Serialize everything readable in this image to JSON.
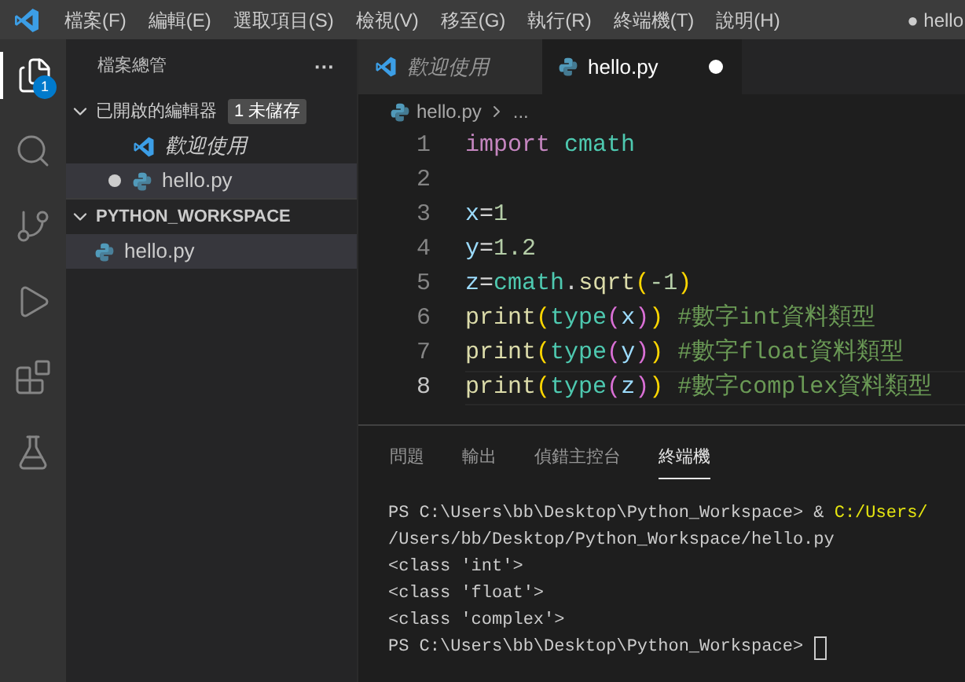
{
  "menu_bar": {
    "items": [
      "檔案(F)",
      "編輯(E)",
      "選取項目(S)",
      "檢視(V)",
      "移至(G)",
      "執行(R)",
      "終端機(T)",
      "說明(H)"
    ],
    "title": "● hello"
  },
  "activity_bar": {
    "items": [
      {
        "kind": "files",
        "selected": true,
        "badge": "1"
      },
      {
        "kind": "search",
        "selected": false
      },
      {
        "kind": "source-control",
        "selected": false
      },
      {
        "kind": "run",
        "selected": false
      },
      {
        "kind": "extensions",
        "selected": false
      },
      {
        "kind": "testing",
        "selected": false
      }
    ]
  },
  "sidebar": {
    "title": "檔案總管",
    "more": "···",
    "sections": [
      {
        "title": "已開啟的編輯器",
        "expanded": true,
        "badge": "1 未儲存",
        "items": [
          {
            "label": "歡迎使用",
            "kind": "welcome",
            "modified": false,
            "selected": false
          },
          {
            "label": "hello.py",
            "kind": "python",
            "modified": true,
            "selected": true
          }
        ]
      },
      {
        "title": "PYTHON_WORKSPACE",
        "expanded": true,
        "items": [
          {
            "label": "hello.py",
            "kind": "python",
            "selected": true
          }
        ]
      }
    ]
  },
  "editor": {
    "tabs": [
      {
        "label": "歡迎使用",
        "kind": "welcome",
        "selected": false,
        "modified": false
      },
      {
        "label": "hello.py",
        "kind": "python",
        "selected": true,
        "modified": true
      }
    ],
    "breadcrumb": [
      "hello.py",
      "..."
    ],
    "lines": [
      {
        "number": "1",
        "current": false,
        "tokens": [
          {
            "text": "import",
            "kind": "keyword"
          },
          {
            "text": " cmath",
            "kind": "module"
          }
        ]
      },
      {
        "number": "2",
        "current": false
      },
      {
        "number": "3",
        "current": false,
        "tokens": [
          {
            "text": "x",
            "kind": "variable"
          },
          {
            "text": "=",
            "kind": "plain"
          },
          {
            "text": "1",
            "kind": "number"
          }
        ]
      },
      {
        "number": "4",
        "current": false,
        "tokens": [
          {
            "text": "y",
            "kind": "variable"
          },
          {
            "text": "=",
            "kind": "plain"
          },
          {
            "text": "1.2",
            "kind": "number"
          }
        ]
      },
      {
        "number": "5",
        "current": false,
        "tokens": [
          {
            "text": "z",
            "kind": "variable"
          },
          {
            "text": "=",
            "kind": "plain"
          },
          {
            "text": "cmath",
            "kind": "module"
          },
          {
            "text": ".",
            "kind": "plain"
          },
          {
            "text": "sqrt",
            "kind": "function"
          },
          {
            "text": "(",
            "kind": "bracket"
          },
          {
            "text": "-1",
            "kind": "number"
          },
          {
            "text": ")",
            "kind": "bracket"
          }
        ]
      },
      {
        "number": "6",
        "current": false,
        "tokens": [
          {
            "text": "print",
            "kind": "function"
          },
          {
            "text": "(",
            "kind": "bracket"
          },
          {
            "text": "type",
            "kind": "module"
          },
          {
            "text": "(",
            "kind": "bracket2"
          },
          {
            "text": "x",
            "kind": "variable"
          },
          {
            "text": ")",
            "kind": "bracket2"
          },
          {
            "text": ")",
            "kind": "bracket"
          },
          {
            "text": " #數字int資料類型",
            "kind": "comment"
          }
        ]
      },
      {
        "number": "7",
        "current": false,
        "tokens": [
          {
            "text": "print",
            "kind": "function"
          },
          {
            "text": "(",
            "kind": "bracket"
          },
          {
            "text": "type",
            "kind": "module"
          },
          {
            "text": "(",
            "kind": "bracket2"
          },
          {
            "text": "y",
            "kind": "variable"
          },
          {
            "text": ")",
            "kind": "bracket2"
          },
          {
            "text": ")",
            "kind": "bracket"
          },
          {
            "text": " #數字float資料類型",
            "kind": "comment"
          }
        ]
      },
      {
        "number": "8",
        "current": true,
        "tokens": [
          {
            "text": "print",
            "kind": "function"
          },
          {
            "text": "(",
            "kind": "bracket"
          },
          {
            "text": "type",
            "kind": "module"
          },
          {
            "text": "(",
            "kind": "bracket2"
          },
          {
            "text": "z",
            "kind": "variable"
          },
          {
            "text": ")",
            "kind": "bracket2"
          },
          {
            "text": ")",
            "kind": "bracket"
          },
          {
            "text": " #數字complex資料類型",
            "kind": "comment"
          }
        ]
      }
    ]
  },
  "panel": {
    "tabs": [
      {
        "label": "問題",
        "selected": false
      },
      {
        "label": "輸出",
        "selected": false
      },
      {
        "label": "偵錯主控台",
        "selected": false
      },
      {
        "label": "終端機",
        "selected": true
      }
    ],
    "terminal": [
      {
        "parts": [
          {
            "text": "PS C:\\Users\\bb\\Desktop\\Python_Workspace> & ",
            "kind": "plain"
          },
          {
            "text": "C:/Users/",
            "kind": "path"
          }
        ]
      },
      {
        "parts": [
          {
            "text": "/Users/bb/Desktop/Python_Workspace/hello.py",
            "kind": "plain"
          }
        ]
      },
      {
        "parts": [
          {
            "text": "<class 'int'>",
            "kind": "plain"
          }
        ]
      },
      {
        "parts": [
          {
            "text": "<class 'float'>",
            "kind": "plain"
          }
        ]
      },
      {
        "parts": [
          {
            "text": "<class 'complex'>",
            "kind": "plain"
          }
        ]
      },
      {
        "parts": [
          {
            "text": "PS C:\\Users\\bb\\Desktop\\Python_Workspace> ",
            "kind": "plain"
          }
        ],
        "cursor": true
      }
    ]
  }
}
